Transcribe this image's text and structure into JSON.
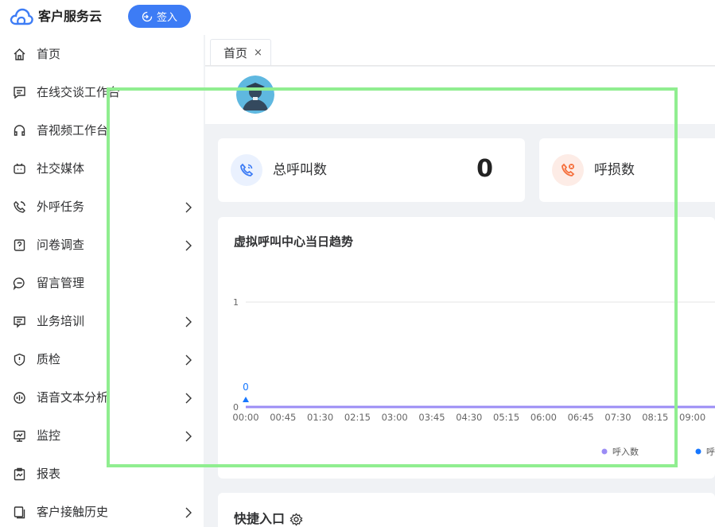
{
  "app": {
    "title": "客户服务云",
    "signin_label": "签入"
  },
  "sidebar": {
    "items": [
      {
        "label": "首页",
        "icon": "home-icon",
        "has_arrow": false
      },
      {
        "label": "在线交谈工作台",
        "icon": "chat-icon",
        "has_arrow": false
      },
      {
        "label": "音视频工作台",
        "icon": "headset-icon",
        "has_arrow": false
      },
      {
        "label": "社交媒体",
        "icon": "social-icon",
        "has_arrow": false
      },
      {
        "label": "外呼任务",
        "icon": "phone-icon",
        "has_arrow": true
      },
      {
        "label": "问卷调查",
        "icon": "survey-icon",
        "has_arrow": true
      },
      {
        "label": "留言管理",
        "icon": "message-icon",
        "has_arrow": false
      },
      {
        "label": "业务培训",
        "icon": "training-icon",
        "has_arrow": true
      },
      {
        "label": "质检",
        "icon": "shield-icon",
        "has_arrow": true
      },
      {
        "label": "语音文本分析",
        "icon": "voice-analysis-icon",
        "has_arrow": true
      },
      {
        "label": "监控",
        "icon": "monitor-icon",
        "has_arrow": true
      },
      {
        "label": "报表",
        "icon": "report-icon",
        "has_arrow": false
      },
      {
        "label": "客户接触历史",
        "icon": "history-icon",
        "has_arrow": true
      }
    ]
  },
  "tabs": [
    {
      "label": "首页",
      "close": "×"
    }
  ],
  "stats": [
    {
      "label": "总呼叫数",
      "value": "0",
      "icon": "phone-call-icon",
      "color": "#3d7cf5"
    },
    {
      "label": "呼损数",
      "value": "",
      "icon": "missed-call-icon",
      "color": "#f5703d"
    }
  ],
  "chart_data": {
    "type": "line",
    "title": "虚拟呼叫中心当日趋势",
    "x": [
      "00:00",
      "00:45",
      "01:30",
      "02:15",
      "03:00",
      "03:45",
      "04:30",
      "05:15",
      "06:00",
      "06:45",
      "07:30",
      "08:15",
      "09:00"
    ],
    "series": [
      {
        "name": "呼入数",
        "color": "#9b8cf5",
        "values": [
          0,
          0,
          0,
          0,
          0,
          0,
          0,
          0,
          0,
          0,
          0,
          0,
          0
        ]
      },
      {
        "name": "呼",
        "color": "#1677ff",
        "values": [
          0,
          0,
          0,
          0,
          0,
          0,
          0,
          0,
          0,
          0,
          0,
          0,
          0
        ]
      }
    ],
    "y_ticks": [
      "0",
      "1"
    ],
    "ylim": [
      0,
      1
    ],
    "point_label": "0",
    "grid": true,
    "legend_position": "bottom"
  },
  "quick": {
    "title": "快捷入口",
    "icon": "gear-icon"
  },
  "colors": {
    "accent": "#3d7cf5",
    "overlay": "#90ee90"
  }
}
